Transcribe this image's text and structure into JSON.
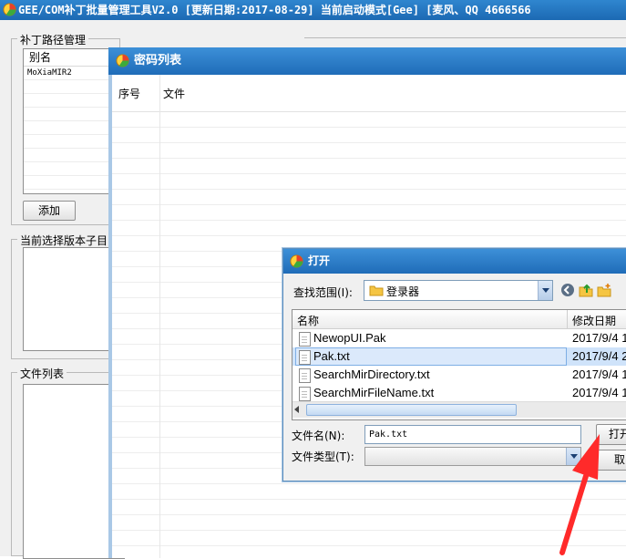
{
  "main_window": {
    "title": "GEE/COM补丁批量管理工具V2.0 [更新日期:2017-08-29]   当前启动模式[Gee]   [麦风、QQ 4666566"
  },
  "patch_paths": {
    "group_label": "补丁路径管理",
    "column_header": "别名",
    "rows": [
      "MoXiaMIR2"
    ],
    "add_button": "添加"
  },
  "version_subdir": {
    "group_label": "当前选择版本子目"
  },
  "file_list_panel": {
    "group_label": "文件列表"
  },
  "password_dialog": {
    "title": "密码列表",
    "columns": [
      "序号",
      "文件"
    ]
  },
  "open_dialog": {
    "title": "打开",
    "look_in_label": "查找范围(I):",
    "look_in_value": "登录器",
    "columns": [
      "名称",
      "修改日期"
    ],
    "files": [
      {
        "name": "NewopUI.Pak",
        "date": "2017/9/4 1"
      },
      {
        "name": "Pak.txt",
        "date": "2017/9/4 2",
        "selected": true
      },
      {
        "name": "SearchMirDirectory.txt",
        "date": "2017/9/4 1"
      },
      {
        "name": "SearchMirFileName.txt",
        "date": "2017/9/4 1"
      }
    ],
    "file_name_label": "文件名(N):",
    "file_name_value": "Pak.txt",
    "file_type_label": "文件类型(T):",
    "file_type_value": "",
    "open_button": "打开",
    "cancel_button": "取"
  },
  "colors": {
    "titlebar": "#1f6cb8",
    "annotation_arrow": "#ff2a2a",
    "selection": "#cfe3fa"
  }
}
